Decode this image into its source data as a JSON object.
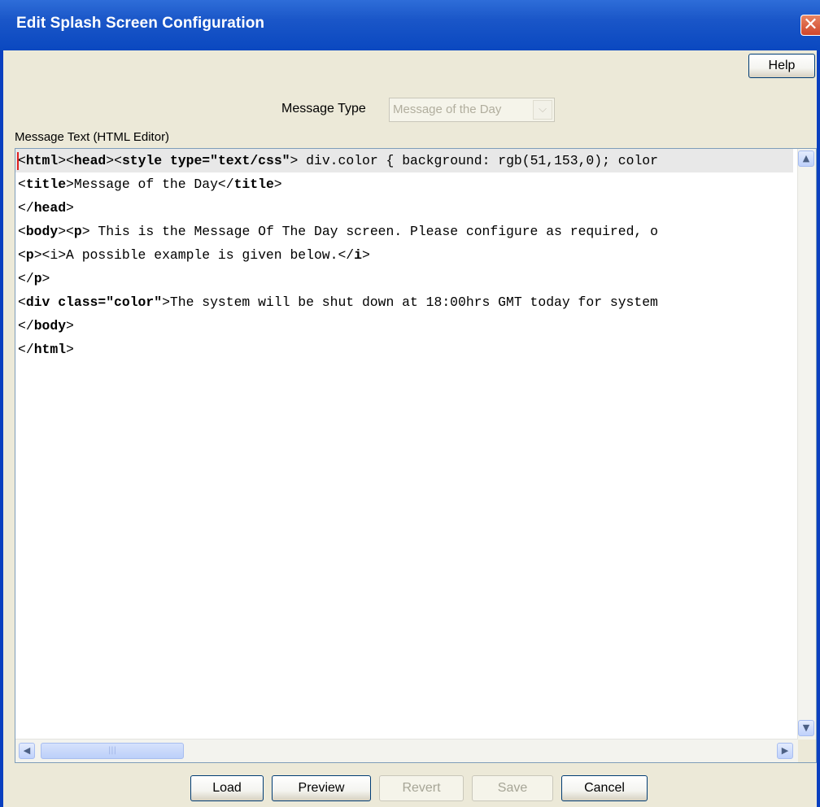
{
  "window": {
    "title": "Edit Splash Screen Configuration",
    "close_glyph": "✕"
  },
  "help_button": {
    "label": "Help"
  },
  "message_type": {
    "label": "Message Type",
    "value": "Message of the Day"
  },
  "editor": {
    "label": "Message Text (HTML Editor)",
    "lines": [
      [
        {
          "t": "<",
          "b": false
        },
        {
          "t": "html",
          "b": true
        },
        {
          "t": "><",
          "b": false
        },
        {
          "t": "head",
          "b": true
        },
        {
          "t": "><",
          "b": false
        },
        {
          "t": "style type=\"text/css\"",
          "b": true
        },
        {
          "t": "> div.color { background: rgb(51,153,0); color",
          "b": false
        }
      ],
      [
        {
          "t": "<",
          "b": false
        },
        {
          "t": "title",
          "b": true
        },
        {
          "t": ">Message of the Day</",
          "b": false
        },
        {
          "t": "title",
          "b": true
        },
        {
          "t": ">",
          "b": false
        }
      ],
      [
        {
          "t": "</",
          "b": false
        },
        {
          "t": "head",
          "b": true
        },
        {
          "t": ">",
          "b": false
        }
      ],
      [
        {
          "t": "<",
          "b": false
        },
        {
          "t": "body",
          "b": true
        },
        {
          "t": "><",
          "b": false
        },
        {
          "t": "p",
          "b": true
        },
        {
          "t": "> This is the Message Of The Day screen. Please configure as required, o",
          "b": false
        }
      ],
      [
        {
          "t": "<",
          "b": false
        },
        {
          "t": "p",
          "b": true
        },
        {
          "t": "><i>A possible example is given below.</",
          "b": false
        },
        {
          "t": "i",
          "b": true
        },
        {
          "t": ">",
          "b": false
        }
      ],
      [
        {
          "t": "</",
          "b": false
        },
        {
          "t": "p",
          "b": true
        },
        {
          "t": ">",
          "b": false
        }
      ],
      [
        {
          "t": "<",
          "b": false
        },
        {
          "t": "div class=\"color\"",
          "b": true
        },
        {
          "t": ">The system will be shut down at 18:00hrs GMT today for system",
          "b": false
        }
      ],
      [
        {
          "t": "</",
          "b": false
        },
        {
          "t": "body",
          "b": true
        },
        {
          "t": ">",
          "b": false
        }
      ],
      [
        {
          "t": "</",
          "b": false
        },
        {
          "t": "html",
          "b": true
        },
        {
          "t": ">",
          "b": false
        }
      ]
    ]
  },
  "buttons": {
    "load": "Load",
    "preview": "Preview",
    "revert": "Revert",
    "save": "Save",
    "cancel": "Cancel"
  },
  "icons": {
    "scroll_up": "chevron-up-icon",
    "scroll_down": "chevron-down-icon",
    "scroll_left": "chevron-left-icon",
    "scroll_right": "chevron-right-icon",
    "close": "close-icon"
  },
  "colors": {
    "title_bar": "#0a48c0",
    "window_bg": "#ece9d8",
    "close_button": "#d0462a"
  }
}
